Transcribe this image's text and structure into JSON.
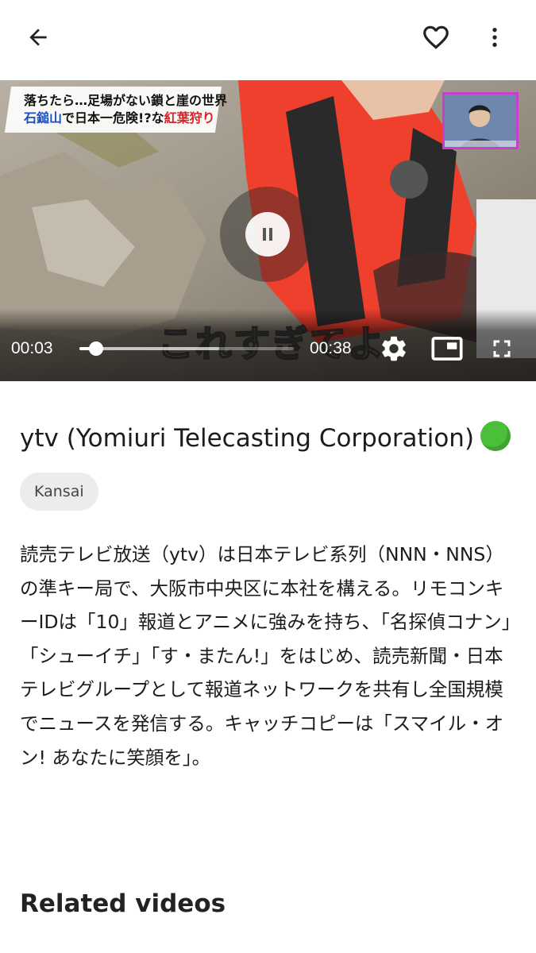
{
  "header": {
    "back_icon": "arrow-left-icon",
    "favorite_icon": "heart-outline-icon",
    "more_icon": "more-vertical-icon"
  },
  "player": {
    "caption_line1": "落ちたら…足場がない鎖と崖の世界",
    "caption_line2_a": "石鎚山",
    "caption_line2_b": "で日本一危険!?な",
    "caption_line2_c": "紅葉狩り",
    "subtitle": "これすぎてよ",
    "current_time": "00:03",
    "duration": "00:38",
    "progress": 0.079,
    "buffered": 0.65,
    "state": "playing",
    "icons": [
      "pause-icon",
      "settings-icon",
      "picture-in-picture-icon",
      "fullscreen-icon"
    ]
  },
  "channel": {
    "title": "ytv (Yomiuri Telecasting Corporation)",
    "status_color": "#4cbf3a",
    "region_tag": "Kansai",
    "description": "読売テレビ放送（ytv）は日本テレビ系列（NNN・NNS）の準キー局で、大阪市中央区に本社を構える。リモコンキーIDは「10」報道とアニメに強みを持ち、「名探偵コナン」「シューイチ」「す・またん!」をはじめ、読売新聞・日本テレビグループとして報道ネットワークを共有し全国規模でニュースを発信する。キャッチコピーは「スマイル・オン! あなたに笑顔を」。"
  },
  "sections": {
    "related_title": "Related videos"
  }
}
